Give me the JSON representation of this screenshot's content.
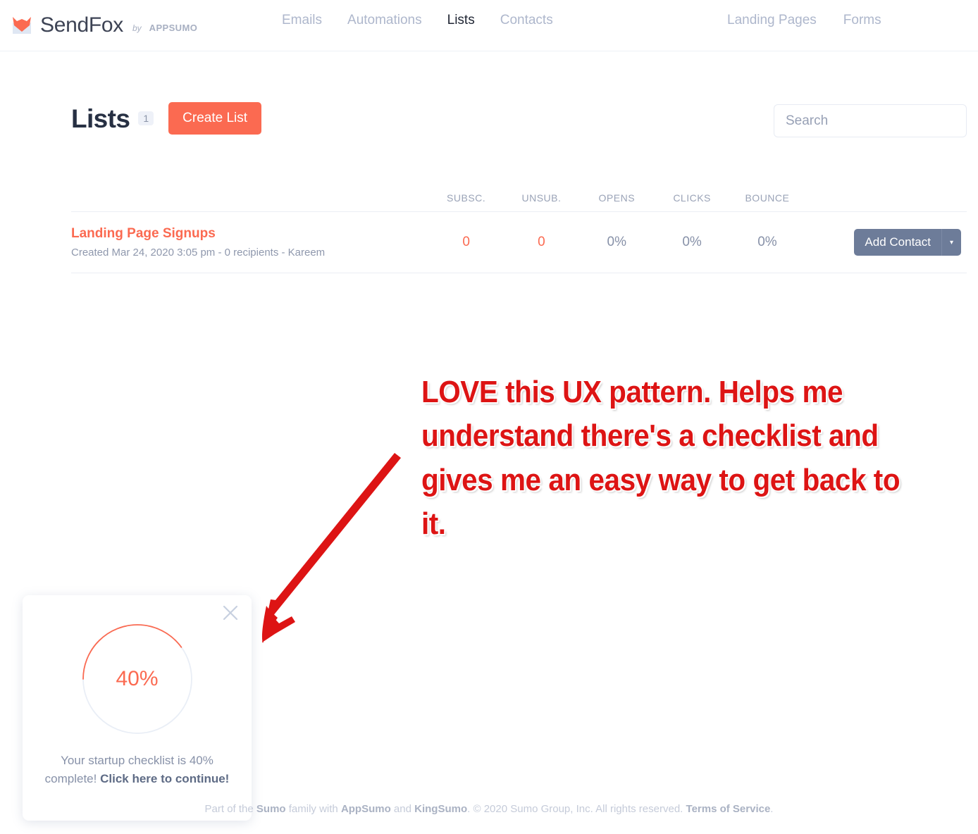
{
  "brand": {
    "name": "SendFox",
    "by": "by",
    "parent": "APPSUMO",
    "logo_icon": "sendfox-fox-envelope-logo"
  },
  "nav": {
    "center": [
      {
        "label": "Emails",
        "active": false
      },
      {
        "label": "Automations",
        "active": false
      },
      {
        "label": "Lists",
        "active": true
      },
      {
        "label": "Contacts",
        "active": false
      }
    ],
    "right": [
      {
        "label": "Landing Pages",
        "active": false
      },
      {
        "label": "Forms",
        "active": false
      }
    ]
  },
  "page": {
    "title": "Lists",
    "count_badge": "1",
    "create_button": "Create List"
  },
  "search": {
    "placeholder": "Search",
    "value": ""
  },
  "table": {
    "headers": [
      "SUBSC.",
      "UNSUB.",
      "OPENS",
      "CLICKS",
      "BOUNCE"
    ],
    "rows": [
      {
        "name": "Landing Page Signups",
        "meta": "Created Mar 24, 2020 3:05 pm - 0 recipients - Kareem",
        "subsc": "0",
        "unsub": "0",
        "opens": "0%",
        "clicks": "0%",
        "bounce": "0%",
        "action_label": "Add Contact",
        "action_caret": "▾"
      }
    ]
  },
  "annotation": {
    "text": "LOVE this UX pattern.  Helps me understand there's a checklist and gives me an easy way to get back to it.",
    "color": "#dd1414",
    "arrow_icon": "red-arrow-pointing-down-left"
  },
  "checklist_widget": {
    "close_icon": "close-x-icon",
    "progress_percent": 40,
    "progress_label": "40%",
    "text_prefix": "Your startup checklist is 40% complete! ",
    "text_link": "Click here to continue!",
    "ring_color": "#fb6a51",
    "track_color": "#e9eef6"
  },
  "footer": {
    "part1": "Part of the ",
    "sumo": "Sumo",
    "part2": " family with ",
    "appsumo": "AppSumo",
    "part3": " and ",
    "kingsumo": "KingSumo",
    "part4": ". © 2020 Sumo Group, Inc. All rights reserved. ",
    "terms": "Terms of Service",
    "part5": "."
  },
  "colors": {
    "accent": "#fb6a51",
    "dark": "#273043",
    "muted": "#8791a8",
    "button_slate": "#6d7c99",
    "annotation_red": "#dd1414"
  }
}
